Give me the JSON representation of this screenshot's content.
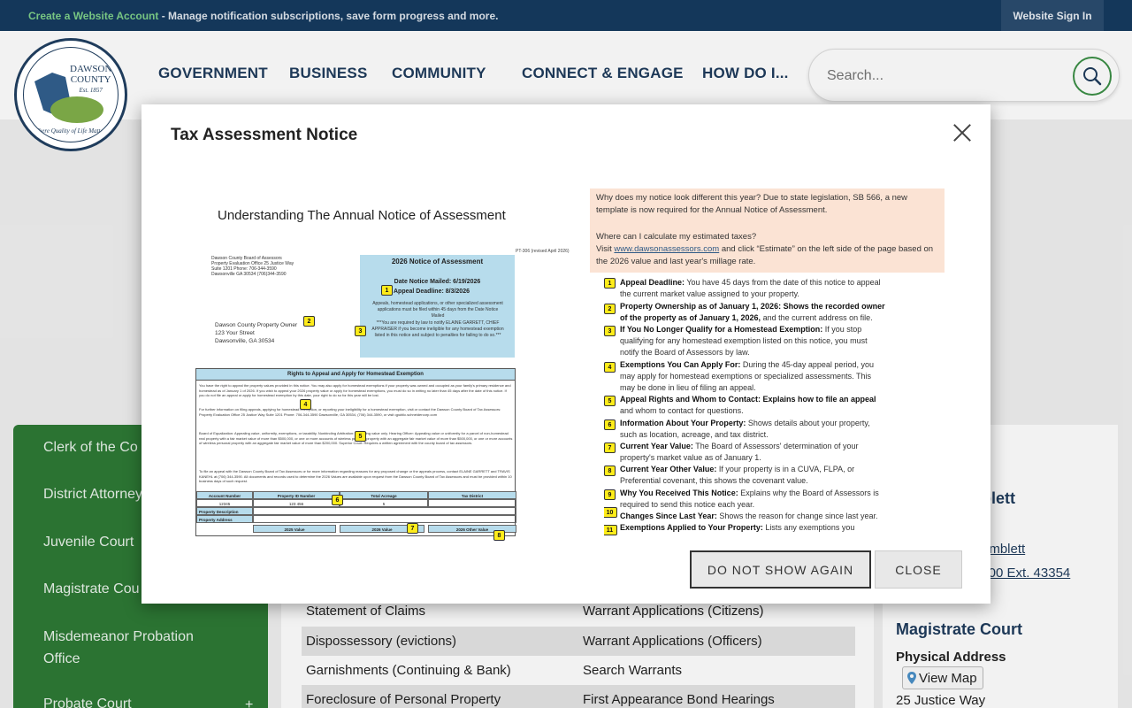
{
  "topbar": {
    "create_link": "Create a Website Account",
    "message": " - Manage notification subscriptions, save form progress and more.",
    "signin": "Website Sign In"
  },
  "logo": {
    "line1": "DAWSON",
    "line2": "COUNTY",
    "line3": "Est. 1857",
    "motto": "\"Where Quality of Life Matters\""
  },
  "nav": {
    "government": "GOVERNMENT",
    "business": "BUSINESS",
    "community": "COMMUNITY",
    "connect": "CONNECT & ENGAGE",
    "howdoi": "HOW DO I..."
  },
  "search": {
    "placeholder": "Search..."
  },
  "sidenav": {
    "items": [
      "Clerk of the Co",
      "District Attorney",
      "Juvenile Court",
      "Magistrate Cou",
      "Misdemeanor Probation Office",
      "Probate Court"
    ],
    "plus": "+"
  },
  "table": {
    "rows": [
      [
        "Statement of Claims",
        "Warrant Applications (Citizens)"
      ],
      [
        "Dispossessory (evictions)",
        "Warrant Applications (Officers)"
      ],
      [
        "Garnishments (Continuing & Bank)",
        "Search Warrants"
      ],
      [
        "Foreclosure of Personal Property",
        "First Appearance Bond Hearings"
      ]
    ]
  },
  "rightcol": {
    "name_partial": "blett",
    "email_partial": "amblett",
    "phone_partial": "-3500 Ext. 43354",
    "section_title": "Magistrate Court",
    "address_label": "Physical Address",
    "view_map": "View Map",
    "street": "25 Justice Way"
  },
  "modal": {
    "title": "Tax Assessment Notice",
    "btn_dont_show": "DO NOT SHOW AGAIN",
    "btn_close": "CLOSE"
  },
  "notice": {
    "heading": "Understanding The Annual Notice of Assessment",
    "form_id": "PT-306 (revised April 2026)",
    "office": "Dawson County Board of Assessors Property Evaluation Office 25 Justice Way Suite 1201 Phone: 706-344-3590 Dawsonville GA 30534 (706)344-3590",
    "owner_name": "Dawson County Property Owner",
    "owner_street": "123 Your Street",
    "owner_city": "Dawsonville, GA 30534",
    "blue_title": "2026 Notice of Assessment",
    "date_mailed": "Date Notice Mailed: 6/19/2026",
    "appeal_deadline": "Appeal Deadline: 8/3/2026",
    "blue_text": "Appeals, homestead applications, or other specialized assessment applications must be filed within 45 days from the Date Notice Mailed",
    "blue_notice": "***You are required by law to notify ELAINE GARRETT, CHIEF APPRAISER if you become ineligible for any homestead exemption listed in this notice and subject to penalties for failing to do so.***",
    "rights_header": "Rights to Appeal and Apply for Homestead Exemption",
    "rights_p1": "You have the right to appeal the property values provided in this notice. You may also apply for homestead exemptions if your property was owned and occupied as your family's primary residence and homestead as of January 1 of 2026. If you wish to appeal your 2026 property value or apply for homestead exemptions, you must do so in writing no later than 45 days after the date of this notice. If you do not file an appeal or apply for homestead exemption by this date, your right to do so for this year will be lost.",
    "rights_p2": "For further information on filing appeals, applying for homestead exemption, or reporting your ineligibility for a homestead exemption, visit or contact the Dawson County Board of Tax Assessors: Property Evaluation Office 25 Justice Way Suite 1201 Phone: 706-344-3590 Dawsonville, GA 30534, (706) 344-3590, or visit qpublic.schneidercorp.com",
    "rights_p3": "Board of Equalization: Appealing value, uniformity, exemptions, or taxability. Nonbinding Arbitration: Appealing value only. Hearing Officer: Appealing value or uniformity for a parcel of non-homestead real property with a fair market value of more than $500,000, or one or more accounts of wireless personal property with an aggregate fair market value of more than $500,000, or one or more accounts of wireless personal property with an aggregate fair market value of more than $200,000. Superior Court: Requires a written agreement with the county board of tax assessors.",
    "rights_p4": "To file an appeal with the Dawson County Board of Tax Assessors or for more information regarding reasons for any proposed change or the appeals process, contact ELAINE GARRETT and TRAVIS KANEHL at (706) 344-3590. All documents and records used to determine the 2026 Values are available upon request from the Dawson County Board of Tax Assessors and must be provided within 10 business days of such request.",
    "grid": {
      "h_account": "Account Number",
      "h_property": "Property ID Number",
      "h_acreage": "Total Acreage",
      "h_tax": "Tax District",
      "account": "12345",
      "property_id": "123 456",
      "acreage": "5",
      "desc_label": "Property Description",
      "addr_label": "Property Address",
      "v2025": "2025 Value",
      "v2026": "2026 Value",
      "v2026o": "2026 Other Value"
    },
    "peach_q1": "Why does my notice look different this year? Due to state legislation, SB 566, a new template is now required for the Annual Notice of Assessment.",
    "peach_q2": "Where can I calculate my estimated taxes?",
    "peach_visit": "Visit ",
    "peach_link": "www.dawsonassessors.com",
    "peach_rest": " and click “Estimate” on the left side of the page based on the 2026 value and last year's millage rate.",
    "items": [
      {
        "n": "1",
        "b": "Appeal Deadline:",
        "t": " You have 45 days from the date of this notice to appeal the current market value assigned to your property."
      },
      {
        "n": "2",
        "b": "Property Ownership as of January 1, 2026: Shows the recorded owner of the property as of January 1, 2026,",
        "t": " and the current address on file."
      },
      {
        "n": "3",
        "b": "If You No Longer Qualify for a Homestead Exemption:",
        "t": " If you stop qualifying for any homestead exemption listed on this notice, you must notify the Board of Assessors by law."
      },
      {
        "n": "4",
        "b": "Exemptions You Can Apply For:",
        "t": " During the 45-day appeal period, you may apply for homestead exemptions or specialized assessments. This may be done in lieu of filing an appeal."
      },
      {
        "n": "5",
        "b": "Appeal Rights and Whom to Contact: Explains how to file an appeal",
        "t": " and whom to contact for questions."
      },
      {
        "n": "6",
        "b": "Information About Your Property:",
        "t": " Shows details about your property, such as location, acreage, and tax district."
      },
      {
        "n": "7",
        "b": "Current Year Value:",
        "t": " The Board of Assessors' determination of your property's market value as of January 1."
      },
      {
        "n": "8",
        "b": "Current Year Other Value:",
        "t": " If your property is in a CUVA, FLPA, or Preferential covenant, this shows the covenant value."
      },
      {
        "n": "9",
        "b": "Why You Received This Notice:",
        "t": " Explains why the Board of Assessors is required to send this notice each year."
      },
      {
        "n": "10",
        "b": "Changes Since Last Year:",
        "t": " Shows the reason for change since last year."
      },
      {
        "n": "11",
        "b": "Exemptions Applied to Your Property:",
        "t": " Lists any exemptions you"
      }
    ],
    "left_badges": [
      "1",
      "2",
      "3",
      "4",
      "5",
      "6",
      "7",
      "8"
    ]
  },
  "colors": {
    "accent_green": "#2e7a35",
    "navy": "#163a5f",
    "badge_yellow": "#ffec1a",
    "notice_blue": "#b7dcec",
    "notice_peach": "#fbe3d4"
  }
}
